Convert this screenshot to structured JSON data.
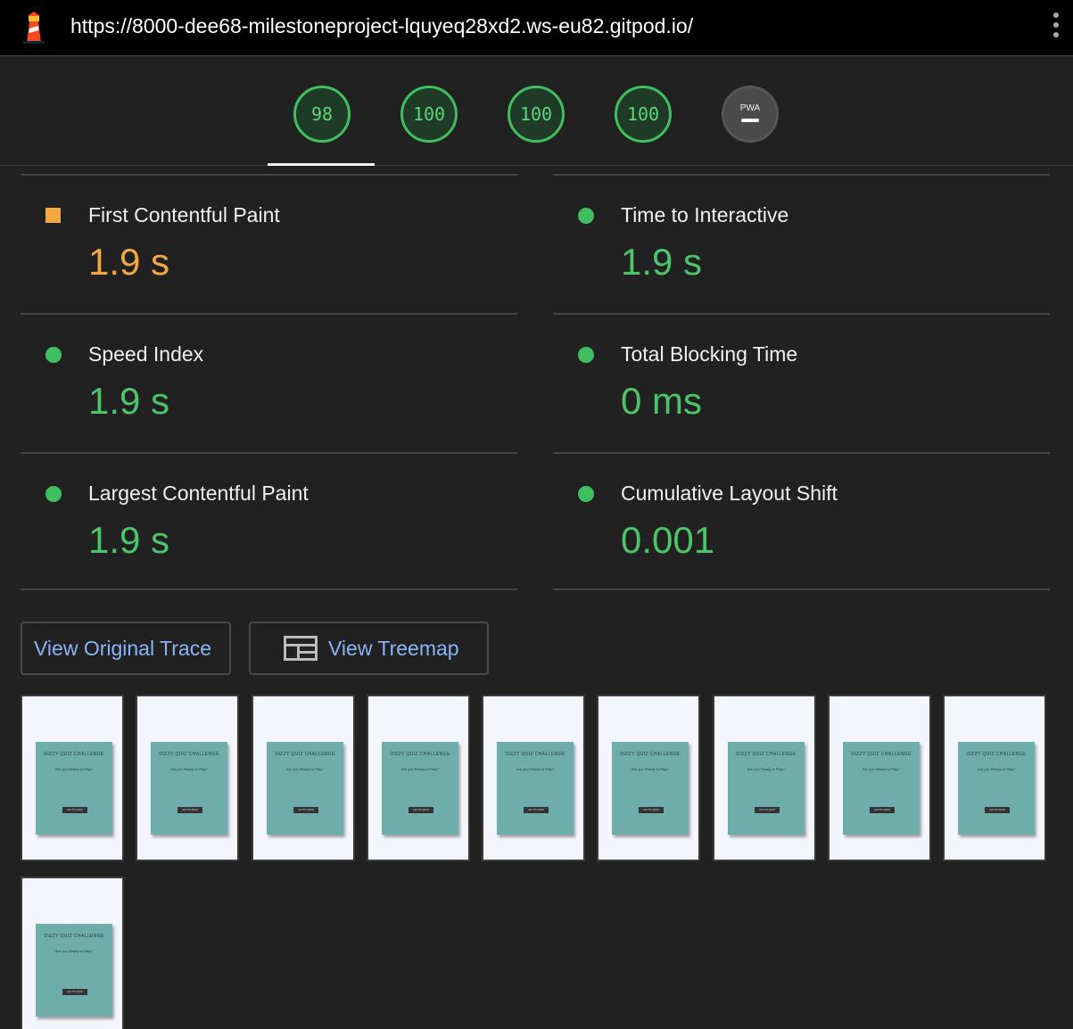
{
  "browser": {
    "url": "https://8000-dee68-milestoneproject-lquyeq28xd2.ws-eu82.gitpod.io/"
  },
  "gauges": [
    {
      "label": "98"
    },
    {
      "label": "100"
    },
    {
      "label": "100"
    },
    {
      "label": "100"
    },
    {
      "label": "PWA"
    }
  ],
  "metrics": [
    {
      "title": "First Contentful Paint",
      "value": "1.9 s",
      "rating": "average"
    },
    {
      "title": "Time to Interactive",
      "value": "1.9 s",
      "rating": "pass"
    },
    {
      "title": "Speed Index",
      "value": "1.9 s",
      "rating": "pass"
    },
    {
      "title": "Total Blocking Time",
      "value": "0 ms",
      "rating": "pass"
    },
    {
      "title": "Largest Contentful Paint",
      "value": "1.9 s",
      "rating": "pass"
    },
    {
      "title": "Cumulative Layout Shift",
      "value": "0.001",
      "rating": "pass"
    }
  ],
  "buttons": {
    "trace": "View Original Trace",
    "treemap": "View Treemap"
  },
  "filmstrip": {
    "frames": [
      {
        "title": "DIZZY QUIZ CHALLENGE",
        "subtitle": "Are you Ready to Play?",
        "button": "GO TO QUIZ"
      },
      {
        "title": "DIZZY QUIZ CHALLENGE",
        "subtitle": "Are you Ready to Play?",
        "button": "GO TO QUIZ"
      },
      {
        "title": "DIZZY QUIZ CHALLENGE",
        "subtitle": "Are you Ready to Play?",
        "button": "GO TO QUIZ"
      },
      {
        "title": "DIZZY QUIZ CHALLENGE",
        "subtitle": "Are you Ready to Play?",
        "button": "GO TO QUIZ"
      },
      {
        "title": "DIZZY QUIZ CHALLENGE",
        "subtitle": "Are you Ready to Play?",
        "button": "GO TO QUIZ"
      },
      {
        "title": "DIZZY QUIZ CHALLENGE",
        "subtitle": "Are you Ready to Play?",
        "button": "GO TO QUIZ"
      },
      {
        "title": "DIZZY QUIZ CHALLENGE",
        "subtitle": "Are you Ready to Play?",
        "button": "GO TO QUIZ"
      },
      {
        "title": "DIZZY QUIZ CHALLENGE",
        "subtitle": "Are you Ready to Play?",
        "button": "GO TO QUIZ"
      },
      {
        "title": "DIZZY QUIZ CHALLENGE",
        "subtitle": "Are you Ready to Play?",
        "button": "GO TO QUIZ"
      },
      {
        "title": "DIZZY QUIZ CHALLENGE",
        "subtitle": "Are you Ready to Play?",
        "button": "GO TO QUIZ"
      }
    ]
  },
  "colors": {
    "pass": "#4cc46a",
    "average": "#f4a841",
    "link": "#8ab4f8",
    "background": "#212121"
  }
}
